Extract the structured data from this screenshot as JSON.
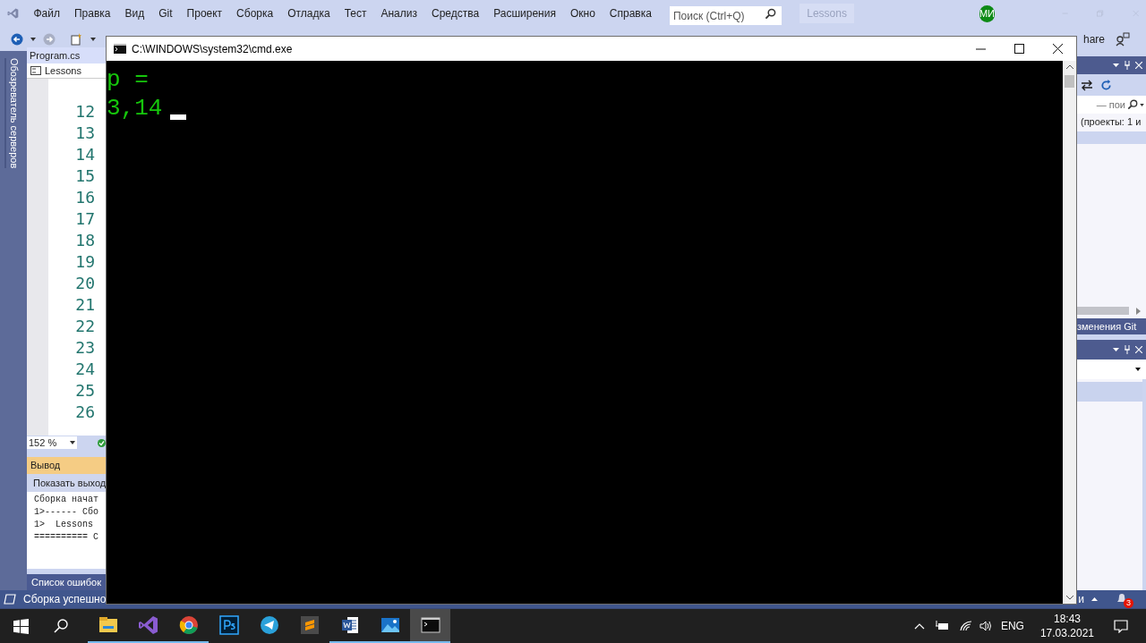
{
  "ide": {
    "menu": [
      {
        "label": "Файл"
      },
      {
        "label": "Правка"
      },
      {
        "label": "Вид"
      },
      {
        "label": "Git"
      },
      {
        "label": "Проект"
      },
      {
        "label": "Сборка"
      },
      {
        "label": "Отладка"
      },
      {
        "label": "Тест"
      },
      {
        "label": "Анализ"
      },
      {
        "label": "Средства"
      },
      {
        "label": "Расширения"
      },
      {
        "label": "Окно"
      },
      {
        "label": "Справка"
      }
    ],
    "search": {
      "placeholder": "Поиск (Ctrl+Q)"
    },
    "solution_name": "Lessons",
    "avatar": "МИ",
    "toolbar_cut_text": "hare",
    "left_tab": "Обозреватель серверов",
    "editor": {
      "tab": "Program.cs",
      "nav": "Lessons",
      "line_numbers": [
        "12",
        "13",
        "14",
        "15",
        "16",
        "17",
        "18",
        "19",
        "20",
        "21",
        "22",
        "23",
        "24",
        "25",
        "26"
      ],
      "zoom": "152 %"
    },
    "output": {
      "title": "Вывод",
      "toolbar_text": "Показать выход",
      "lines": [
        "Сборка начат",
        "1>------ Сбо",
        "1>  Lessons",
        "========== С"
      ]
    },
    "error_list_tab": "Список ошибок",
    "right_panel": {
      "search_text": "— пои",
      "info_text": "(проекты: 1 и",
      "git_tab": "зменения Git"
    },
    "status": {
      "message": "Сборка успешно",
      "right_text": "и",
      "notifications": "3"
    }
  },
  "console": {
    "title": "C:\\WINDOWS\\system32\\cmd.exe",
    "lines": [
      "p =",
      "3,14"
    ]
  },
  "taskbar": {
    "apps": [
      {
        "kind": "explorer",
        "running": true,
        "selected": false
      },
      {
        "kind": "visualstudio",
        "running": true,
        "selected": false
      },
      {
        "kind": "chrome",
        "running": true,
        "selected": false
      },
      {
        "kind": "photoshop",
        "running": false,
        "selected": false
      },
      {
        "kind": "telegram",
        "running": false,
        "selected": false
      },
      {
        "kind": "sublime",
        "running": false,
        "selected": false
      },
      {
        "kind": "word",
        "running": true,
        "selected": false
      },
      {
        "kind": "photos",
        "running": true,
        "selected": false
      },
      {
        "kind": "console",
        "running": true,
        "selected": true
      }
    ],
    "language": "ENG",
    "time": "18:43",
    "date": "17.03.2021"
  }
}
